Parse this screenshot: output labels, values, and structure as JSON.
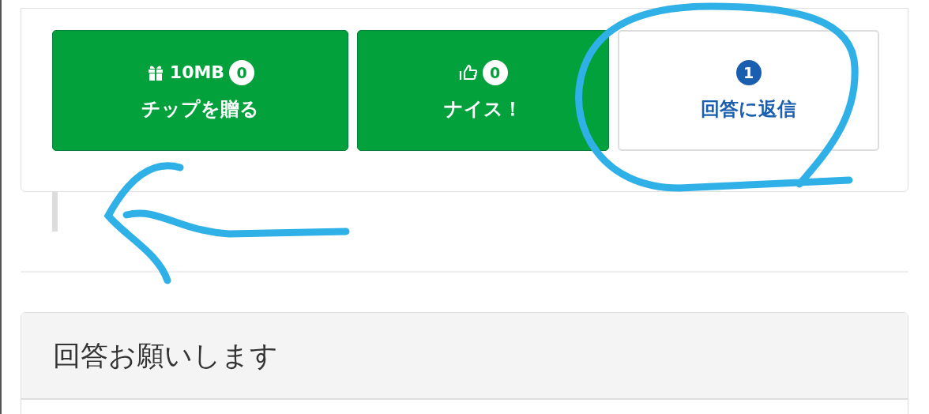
{
  "buttons": [
    {
      "kind": "tip",
      "amount": "10MB",
      "count": "0",
      "label": "チップを贈る"
    },
    {
      "kind": "nice",
      "count": "0",
      "label": "ナイス！"
    },
    {
      "kind": "reply",
      "count": "1",
      "label": "回答に返信"
    }
  ],
  "next_panel": {
    "title": "回答お願いします"
  }
}
